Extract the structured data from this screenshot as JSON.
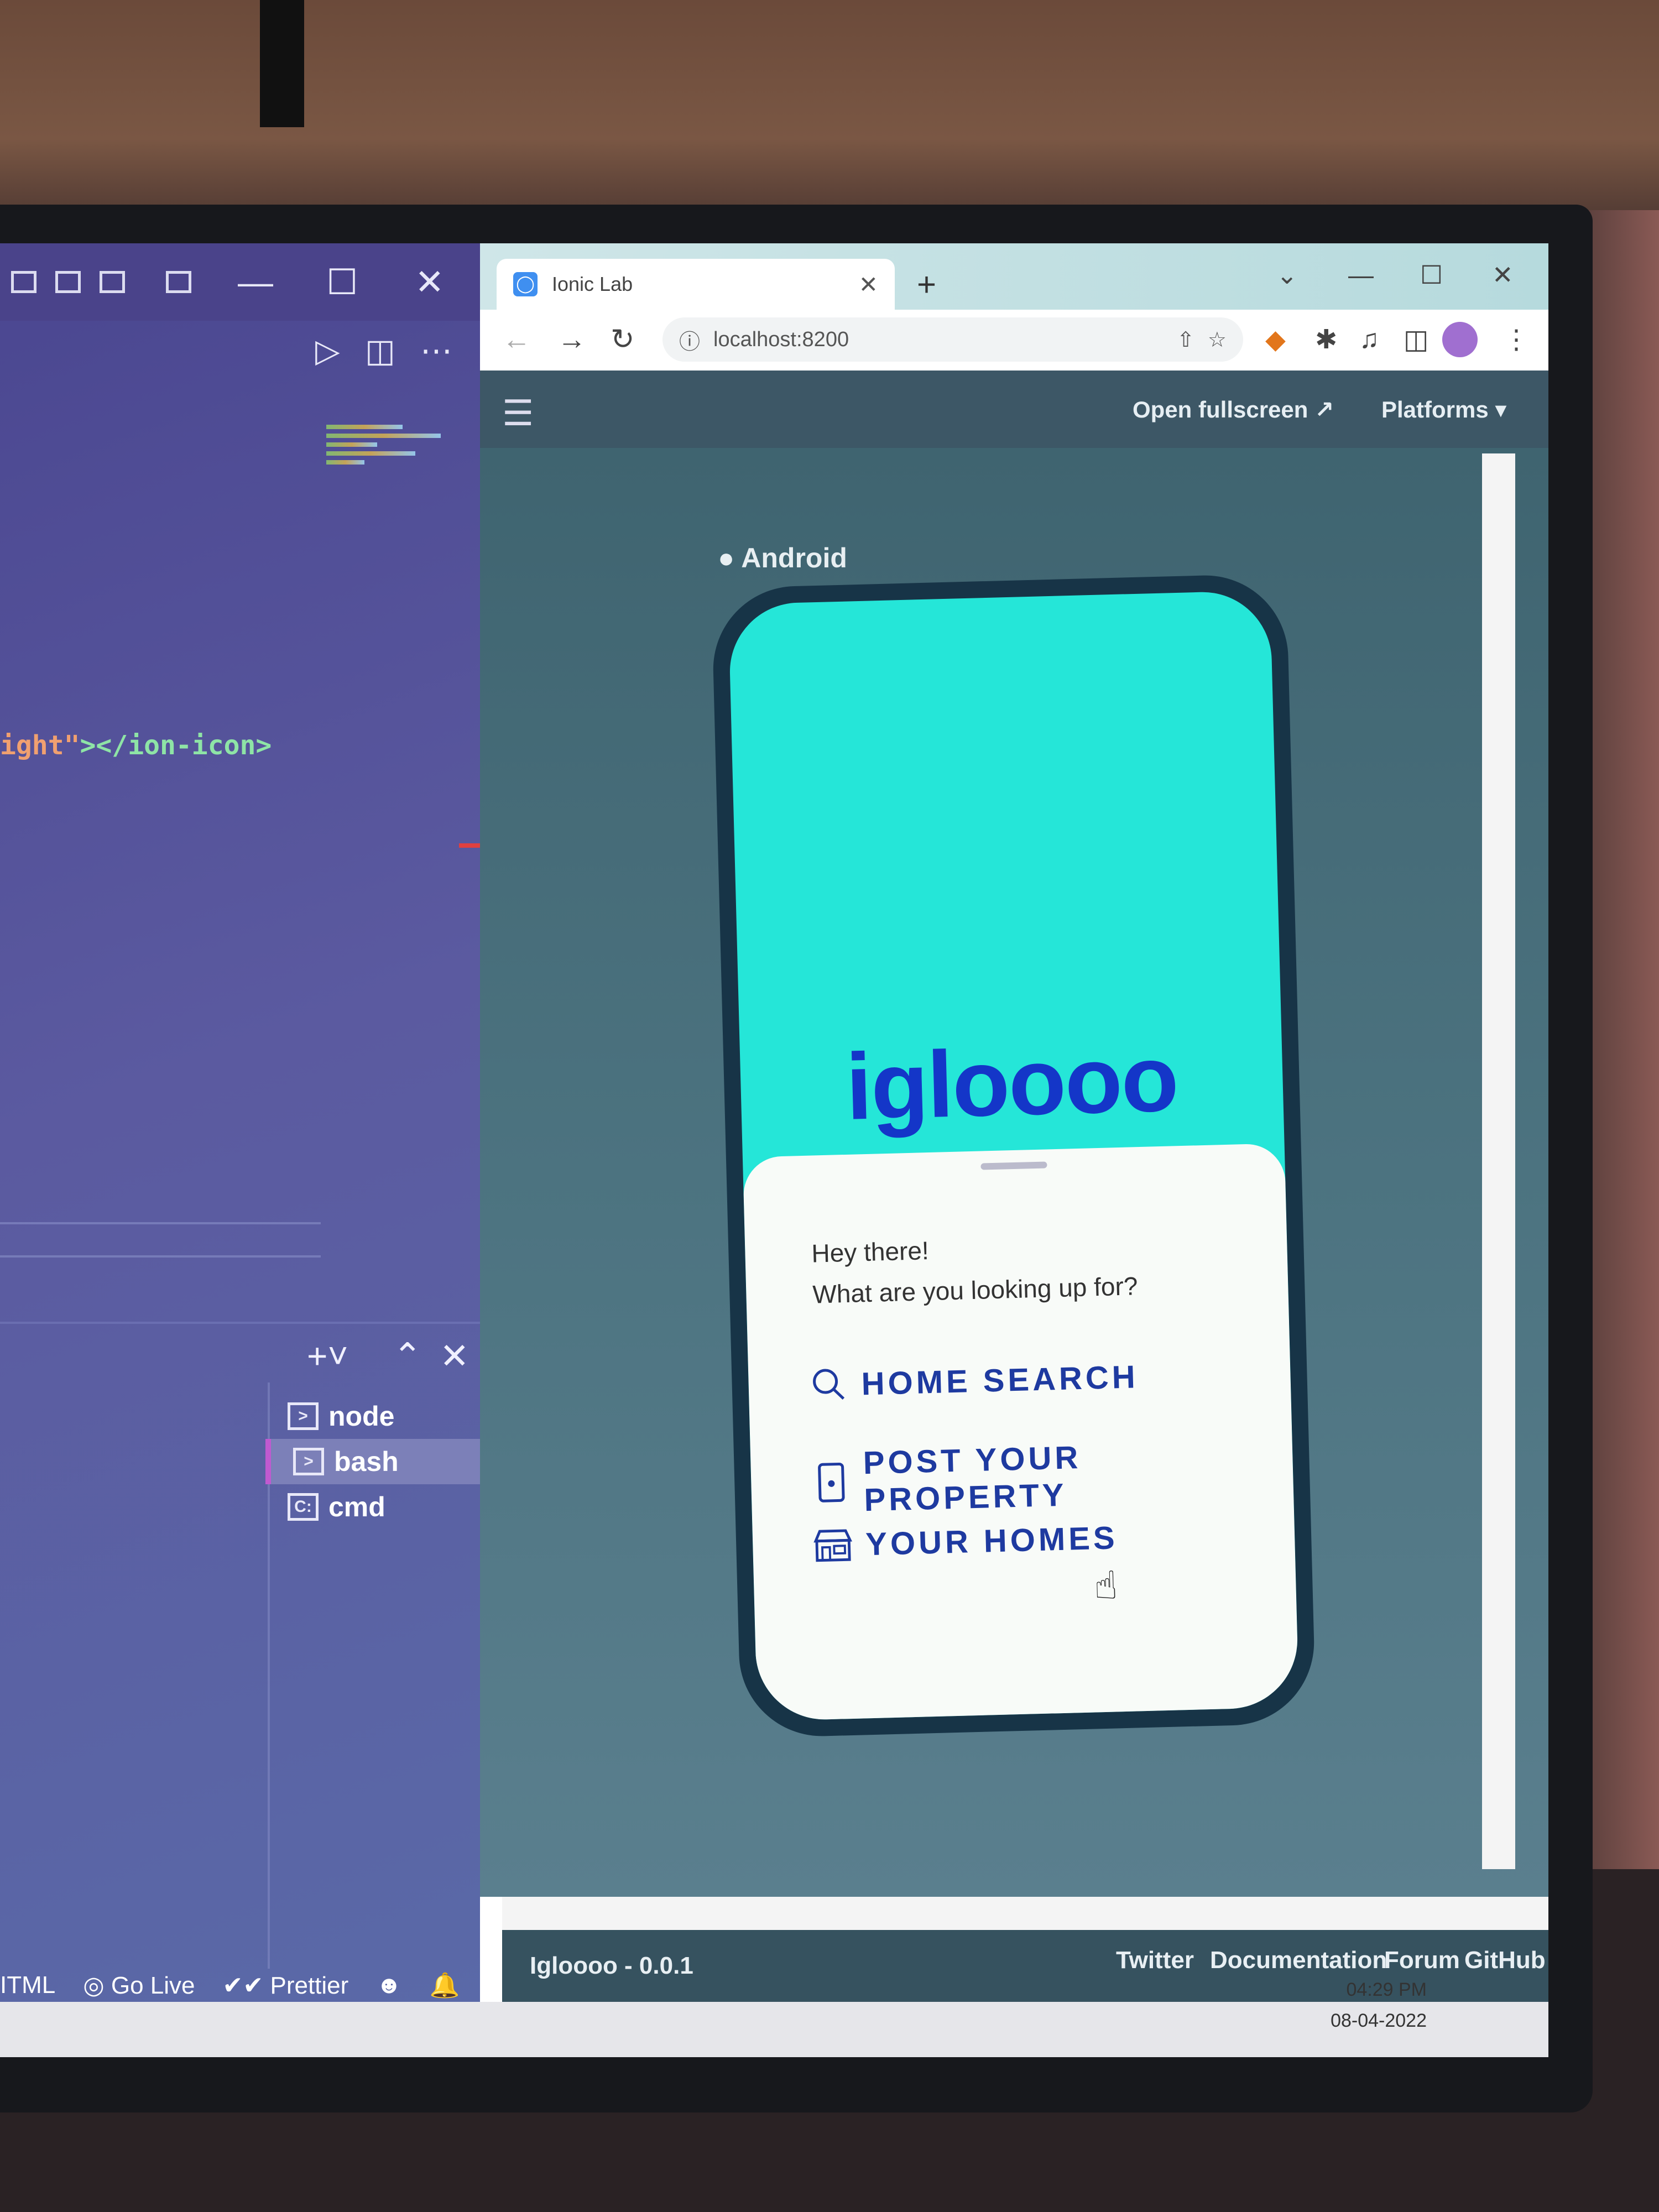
{
  "editor": {
    "code_line": {
      "part1": "ight\"",
      "part2": "></ion-icon>"
    },
    "terminals": [
      "node",
      "bash",
      "cmd"
    ],
    "active_terminal": "bash",
    "status": {
      "lang": "ITML",
      "golive": "Go Live",
      "prettier": "Prettier"
    }
  },
  "browser": {
    "tab_title": "Ionic Lab",
    "url": "localhost:8200"
  },
  "lab": {
    "open_fullscreen": "Open fullscreen",
    "platforms": "Platforms",
    "platform_label": "Android",
    "version": "Igloooo - 0.0.1",
    "footer_links": [
      "Twitter",
      "Documentation",
      "Forum",
      "GitHub"
    ]
  },
  "app": {
    "title": "igloooo",
    "greeting_line1": "Hey there!",
    "greeting_line2": "What are you looking up for?",
    "menu": [
      {
        "label": "HOME SEARCH",
        "icon": "search-icon"
      },
      {
        "label": "POST YOUR PROPERTY",
        "icon": "phone-icon"
      },
      {
        "label": "YOUR HOMES",
        "icon": "storefront-icon"
      }
    ],
    "colors": {
      "accent": "#25e6d8",
      "brand": "#1436c8"
    }
  },
  "taskbar": {
    "time": "04:29 PM",
    "date": "08-04-2022"
  }
}
